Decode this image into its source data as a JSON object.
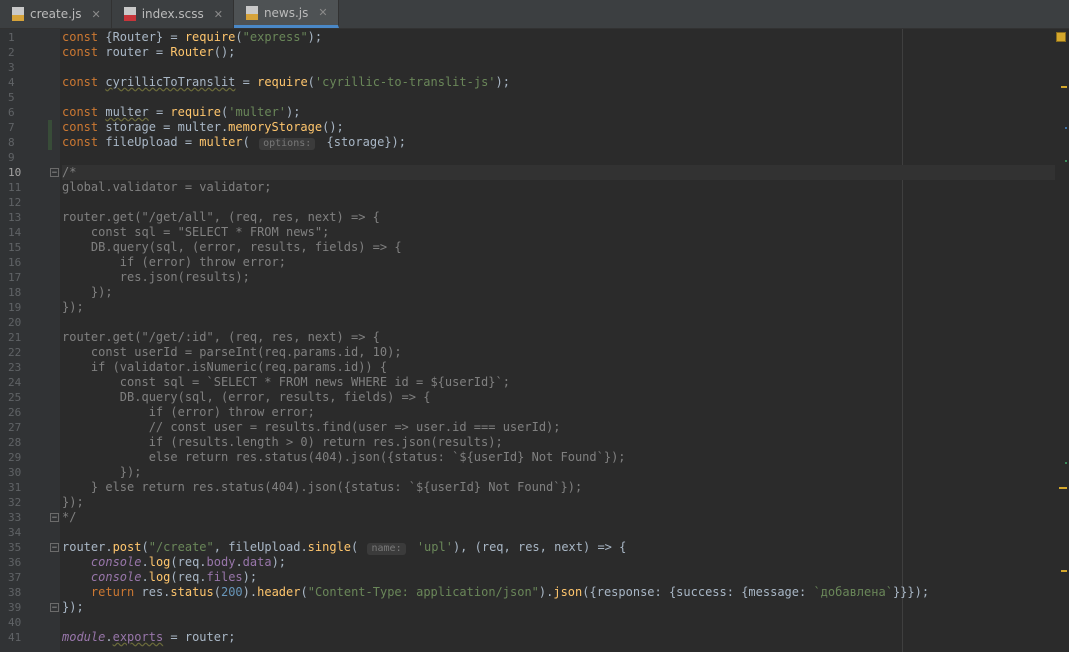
{
  "tabs": [
    {
      "label": "create.js",
      "icon": "js-file-icon",
      "type": "js",
      "active": false
    },
    {
      "label": "index.scss",
      "icon": "scss-file-icon",
      "type": "scss",
      "active": false
    },
    {
      "label": "news.js",
      "icon": "js-file-icon",
      "type": "js",
      "active": true
    }
  ],
  "editor": {
    "current_line": 10,
    "line_numbers": [
      "1",
      "2",
      "3",
      "4",
      "5",
      "6",
      "7",
      "8",
      "9",
      "10",
      "11",
      "12",
      "13",
      "14",
      "15",
      "16",
      "17",
      "18",
      "19",
      "20",
      "21",
      "22",
      "23",
      "24",
      "25",
      "26",
      "27",
      "28",
      "29",
      "30",
      "31",
      "32",
      "33",
      "34",
      "35",
      "36",
      "37",
      "38",
      "39",
      "40",
      "41"
    ],
    "lines": [
      "const {Router} = require(\"express\");",
      "const router = Router();",
      "",
      "const cyrillicToTranslit = require('cyrillic-to-translit-js');",
      "",
      "const multer = require('multer');",
      "const storage = multer.memoryStorage();",
      "const fileUpload = multer( options: {storage});",
      "",
      "/*",
      "global.validator = validator;",
      "",
      "router.get(\"/get/all\", (req, res, next) => {",
      "    const sql = \"SELECT * FROM news\";",
      "    DB.query(sql, (error, results, fields) => {",
      "        if (error) throw error;",
      "        res.json(results);",
      "    });",
      "});",
      "",
      "router.get(\"/get/:id\", (req, res, next) => {",
      "    const userId = parseInt(req.params.id, 10);",
      "    if (validator.isNumeric(req.params.id)) {",
      "        const sql = `SELECT * FROM news WHERE id = ${userId}`;",
      "        DB.query(sql, (error, results, fields) => {",
      "            if (error) throw error;",
      "            // const user = results.find(user => user.id === userId);",
      "            if (results.length > 0) return res.json(results);",
      "            else return res.status(404).json({status: `${userId} Not Found`});",
      "        });",
      "    } else return res.status(404).json({status: `${userId} Not Found`});",
      "});",
      "*/",
      "",
      "router.post(\"/create\", fileUpload.single( name: 'upl'), (req, res, next) => {",
      "    console.log(req.body.data);",
      "    console.log(req.files);",
      "    return res.status(200).header(\"Content-Type: application/json\").json({response: {success: {message: `добавлена`}}});",
      "});",
      "",
      "module.exports = router;"
    ]
  },
  "colors": {
    "keyword": "#cc7832",
    "string": "#6a8759",
    "function": "#ffc66d",
    "number": "#6897bb",
    "comment": "#808080",
    "property": "#9876aa",
    "default": "#a9b7c6",
    "warning": "#d4a72c"
  }
}
